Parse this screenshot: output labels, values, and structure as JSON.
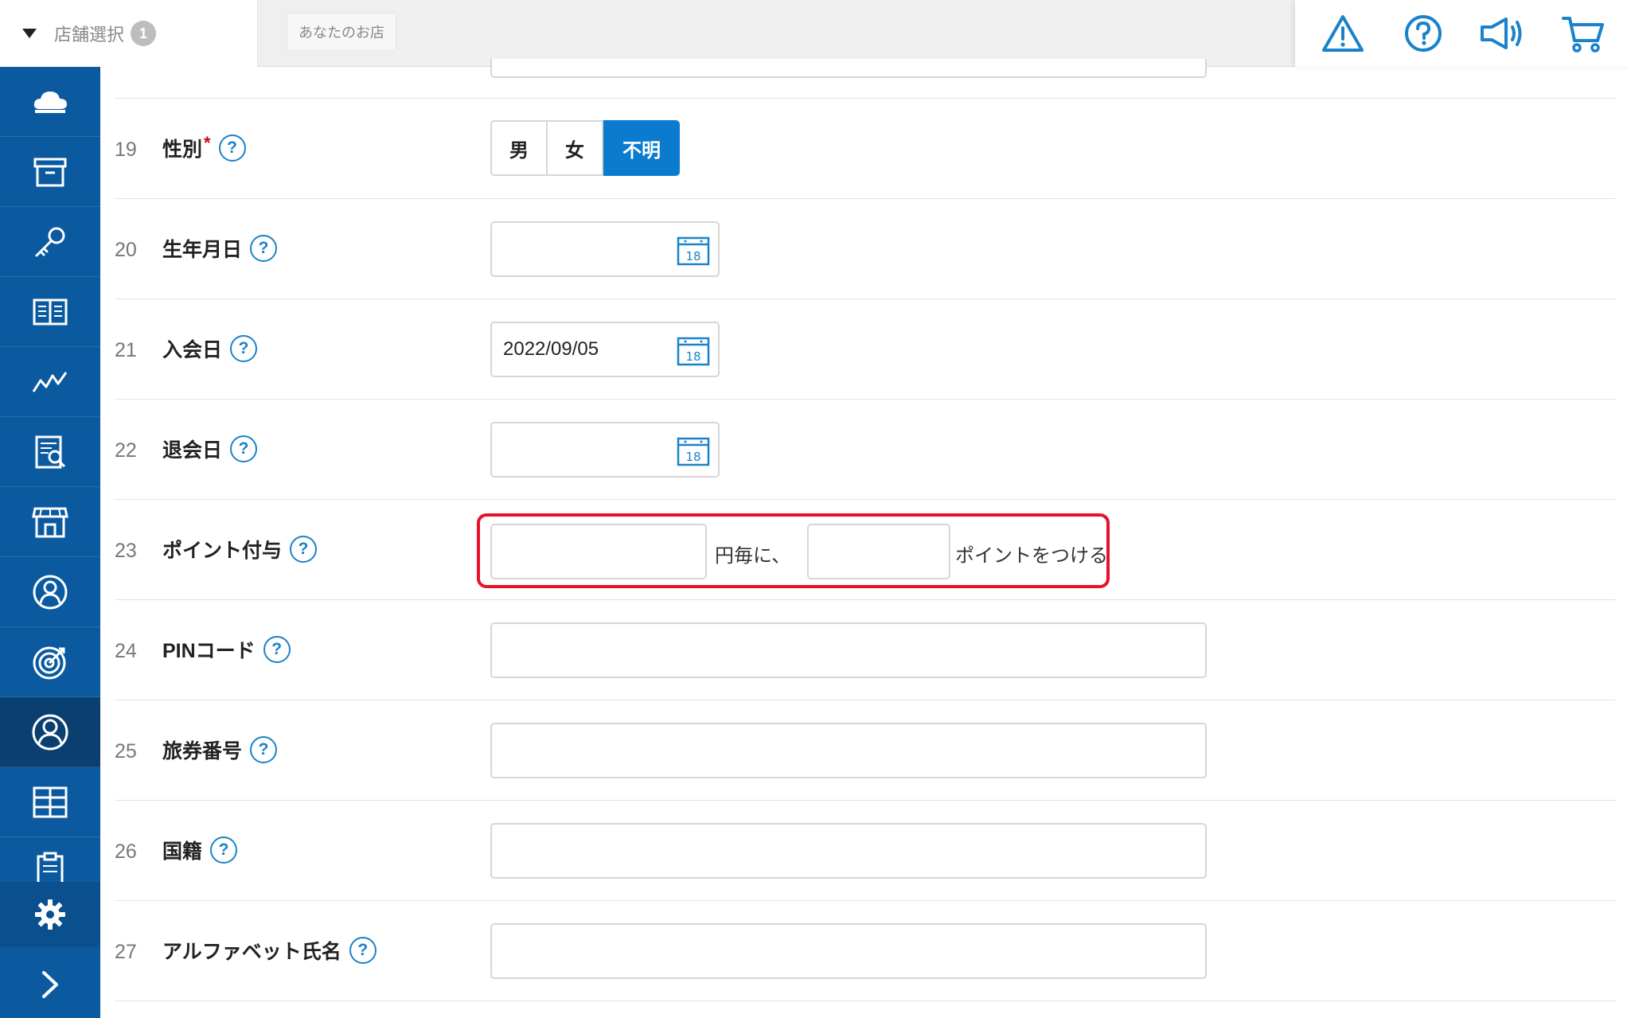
{
  "header": {
    "store_select_label": "店舗選択",
    "store_count": "1",
    "store_name": "あなたのお店",
    "icons": [
      "warning-icon",
      "help-circle-icon",
      "megaphone-icon",
      "cart-icon"
    ]
  },
  "sidebar": {
    "items": [
      "cloud-icon",
      "archive-box-icon",
      "key-icon",
      "book-icon",
      "chart-line-icon",
      "report-icon",
      "store-icon",
      "user-badge-icon",
      "target-icon",
      "user-circle-icon",
      "grid-icon",
      "clipboard-icon"
    ],
    "active": "user-circle-icon",
    "bottom": [
      "gear-icon",
      "chevron-right-icon"
    ]
  },
  "form": {
    "help_glyph": "?",
    "required_mark": "*",
    "rows": [
      {
        "num": "19",
        "label": "性別"
      },
      {
        "num": "20",
        "label": "生年月日"
      },
      {
        "num": "21",
        "label": "入会日"
      },
      {
        "num": "22",
        "label": "退会日"
      },
      {
        "num": "23",
        "label": "ポイント付与"
      },
      {
        "num": "24",
        "label": "PINコード"
      },
      {
        "num": "25",
        "label": "旅券番号"
      },
      {
        "num": "26",
        "label": "国籍"
      },
      {
        "num": "27",
        "label": "アルファベット氏名"
      }
    ],
    "gender_options": [
      "男",
      "女",
      "不明"
    ],
    "gender_selected": "不明",
    "birthday_value": "",
    "join_date_value": "2022/09/05",
    "leave_date_value": "",
    "calendar_day": "18",
    "point_text_1": "円毎に、",
    "point_text_2": "ポイントをつける",
    "accent_color": "#0b7bd0",
    "highlight_color": "#e8102a"
  }
}
